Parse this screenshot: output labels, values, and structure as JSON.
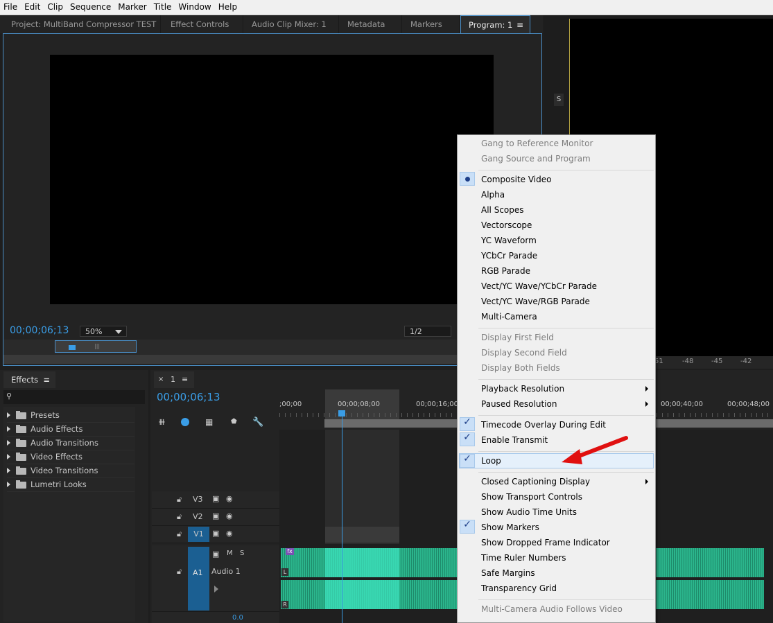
{
  "menubar": [
    "File",
    "Edit",
    "Clip",
    "Sequence",
    "Marker",
    "Title",
    "Window",
    "Help"
  ],
  "top_tabs": [
    {
      "label": "Project: MultiBand Compressor TEST"
    },
    {
      "label": "Effect Controls"
    },
    {
      "label": "Audio Clip Mixer: 1"
    },
    {
      "label": "Metadata"
    },
    {
      "label": "Markers"
    },
    {
      "label": "Program: 1"
    }
  ],
  "program": {
    "timecode": "00;00;06;13",
    "zoom": "50%",
    "resolution": "1/2"
  },
  "side_panel": {
    "solo_label": "S"
  },
  "meter_scale": [
    "51",
    "-48",
    "-45",
    "-42"
  ],
  "effects_panel": {
    "tab": "Effects",
    "items": [
      "Presets",
      "Audio Effects",
      "Audio Transitions",
      "Video Effects",
      "Video Transitions",
      "Lumetri Looks"
    ]
  },
  "timeline": {
    "tab": "1",
    "timecode": "00;00;06;13",
    "ruler": [
      ";00;00",
      "00;00;08;00",
      "00;00;16;00",
      "00;00;40;00",
      "00;00;48;00"
    ],
    "tracks": [
      {
        "id": "V3"
      },
      {
        "id": "V2"
      },
      {
        "id": "V1"
      }
    ],
    "audio": {
      "id": "A1",
      "name": "Audio 1",
      "m": "M",
      "s": "S",
      "ch_l": "L",
      "ch_r": "R",
      "fx": "fx"
    },
    "bottom_value": "0.0"
  },
  "context_menu": {
    "items": [
      {
        "label": "Gang to Reference Monitor",
        "disabled": true
      },
      {
        "label": "Gang Source and Program",
        "disabled": true
      },
      {
        "label": "Composite Video",
        "radio": true
      },
      {
        "label": "Alpha"
      },
      {
        "label": "All Scopes"
      },
      {
        "label": "Vectorscope"
      },
      {
        "label": "YC Waveform"
      },
      {
        "label": "YCbCr Parade"
      },
      {
        "label": "RGB Parade"
      },
      {
        "label": "Vect/YC Wave/YCbCr Parade"
      },
      {
        "label": "Vect/YC Wave/RGB Parade"
      },
      {
        "label": "Multi-Camera"
      },
      {
        "label": "Display First Field",
        "disabled": true
      },
      {
        "label": "Display Second Field",
        "disabled": true
      },
      {
        "label": "Display Both Fields",
        "disabled": true
      },
      {
        "label": "Playback Resolution",
        "submenu": true
      },
      {
        "label": "Paused Resolution",
        "submenu": true
      },
      {
        "label": "Timecode Overlay During Edit",
        "checked": true
      },
      {
        "label": "Enable Transmit",
        "checked": true
      },
      {
        "label": "Loop",
        "checked": true,
        "highlighted": true
      },
      {
        "label": "Closed Captioning Display",
        "submenu": true
      },
      {
        "label": "Show Transport Controls"
      },
      {
        "label": "Show Audio Time Units"
      },
      {
        "label": "Show Markers",
        "checked": true
      },
      {
        "label": "Show Dropped Frame Indicator"
      },
      {
        "label": "Time Ruler Numbers"
      },
      {
        "label": "Safe Margins"
      },
      {
        "label": "Transparency Grid"
      },
      {
        "label": "Multi-Camera Audio Follows Video",
        "disabled": true
      }
    ]
  },
  "colors": {
    "accent": "#3a9de6",
    "arrow": "#e01010",
    "audio_wave": "#2bb58c",
    "audio_wave_selected": "#3fe6c0"
  }
}
